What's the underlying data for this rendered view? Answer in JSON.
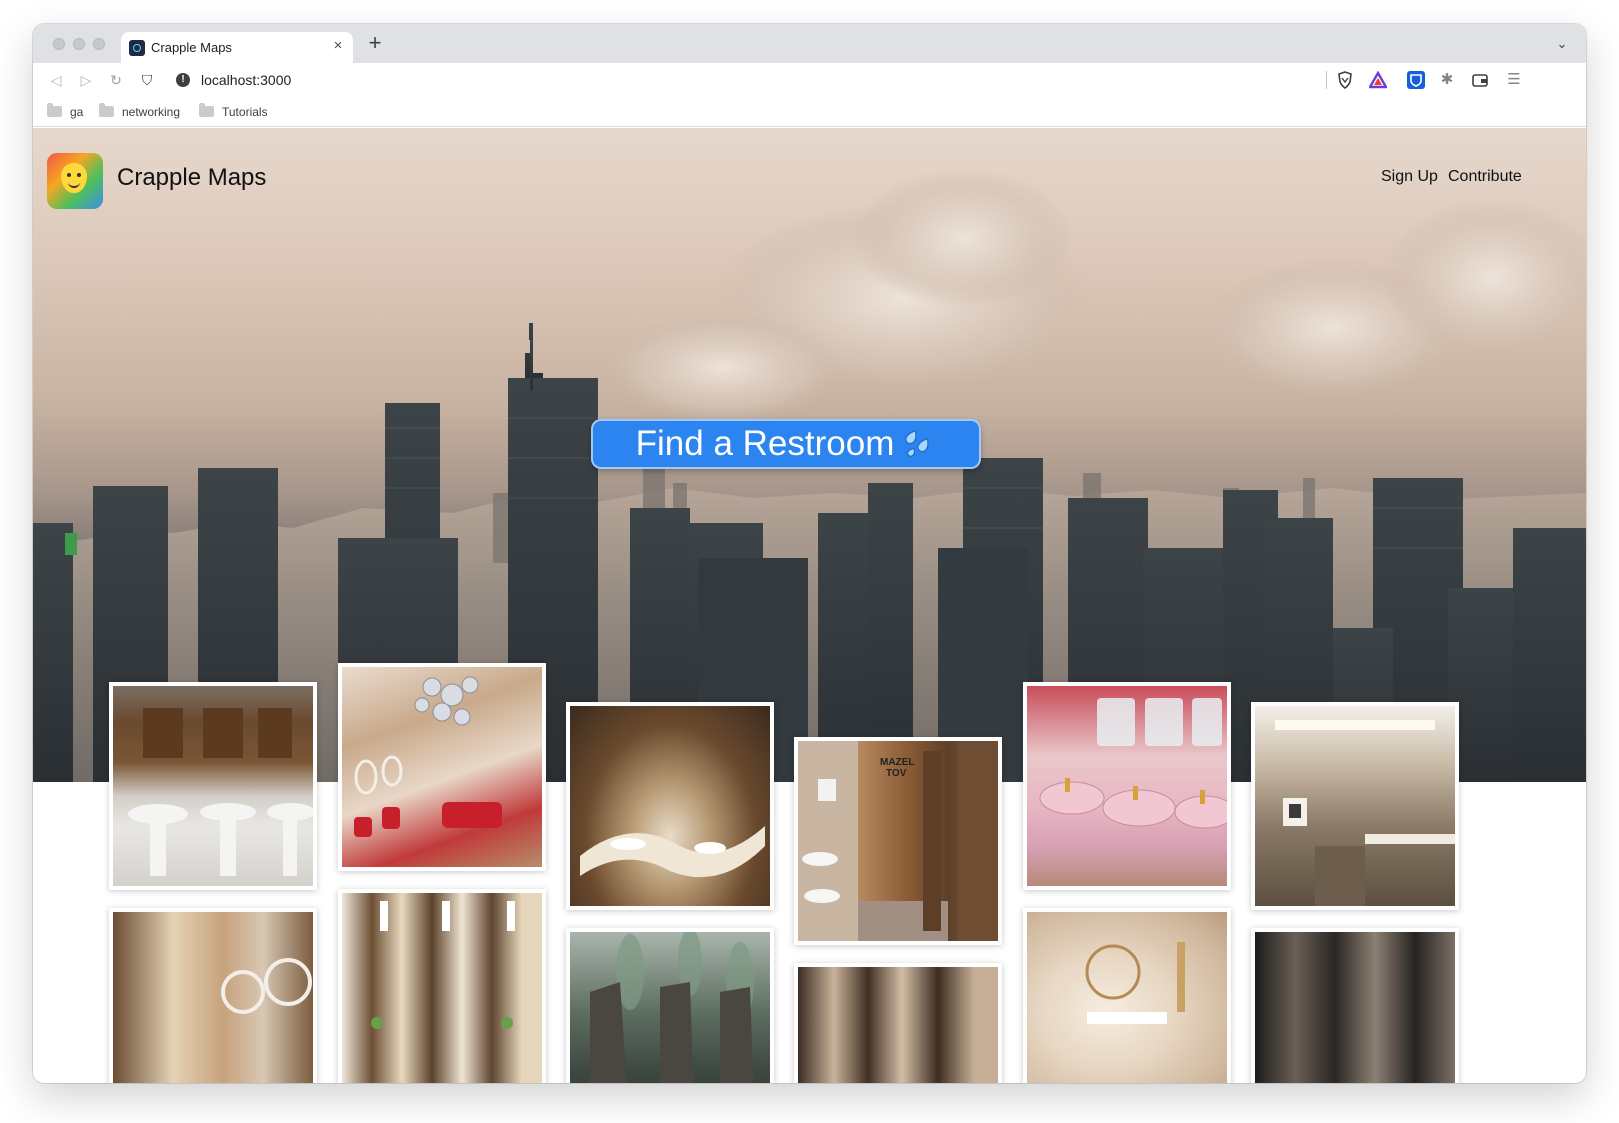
{
  "browser": {
    "tab": {
      "title": "Crapple Maps",
      "close_glyph": "×"
    },
    "new_tab_glyph": "+",
    "tab_dropdown_glyph": "⌄",
    "toolbar": {
      "back_glyph": "◁",
      "forward_glyph": "▷",
      "reload_glyph": "↻",
      "bookmark_glyph": "⛉",
      "info_glyph": "!",
      "url": "localhost:3000"
    },
    "extensions": [
      "brave-shield-icon",
      "brave-rewards-icon",
      "bitwarden-icon",
      "puzzle-icon",
      "wallet-icon",
      "menu-icon"
    ],
    "puzzle_glyph": "✱",
    "menu_glyph": "☰",
    "bookmarks": [
      {
        "label": "ga"
      },
      {
        "label": "networking"
      },
      {
        "label": "Tutorials"
      }
    ]
  },
  "site": {
    "brand": "Crapple Maps",
    "nav": {
      "signup": "Sign Up",
      "contribute": "Contribute"
    },
    "cta": {
      "label": "Find a Restroom",
      "icon": "sweat-droplets-icon"
    },
    "accent_color": "#2b84f0"
  },
  "gallery": {
    "items": [
      {
        "name": "restroom-photo-sinks-wood-doors"
      },
      {
        "name": "restroom-photo-red-seats-chandelier"
      },
      {
        "name": "restroom-photo-curved-wood-vanity"
      },
      {
        "name": "restroom-photo-mazel-tov"
      },
      {
        "name": "restroom-photo-pink-marble-sinks"
      },
      {
        "name": "restroom-photo-modern-beige"
      },
      {
        "name": "restroom-photo-round-mirrors"
      },
      {
        "name": "restroom-photo-wood-pillars"
      },
      {
        "name": "restroom-photo-leaf-stalls"
      },
      {
        "name": "restroom-photo-dark-stalls"
      },
      {
        "name": "restroom-photo-round-mirror-vanity"
      },
      {
        "name": "restroom-photo-dark-lit-hall"
      }
    ],
    "sign_text": "MAZEL TOV"
  }
}
